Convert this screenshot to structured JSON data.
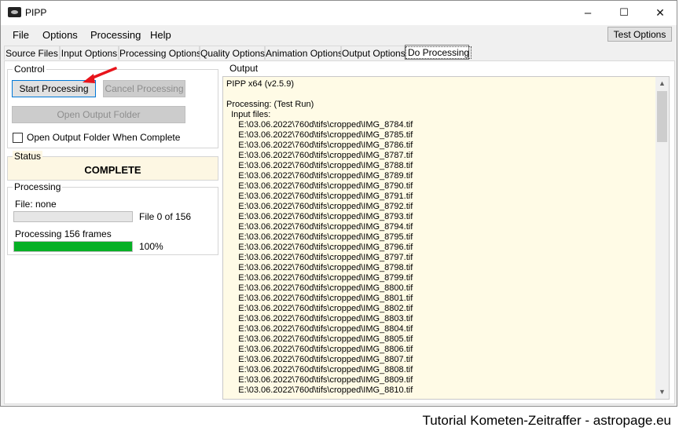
{
  "window": {
    "title": "PIPP",
    "minimize": "–",
    "maximize": "☐",
    "close": "✕"
  },
  "menu": [
    "File",
    "Options",
    "Processing",
    "Help"
  ],
  "test_options_label": "Test Options",
  "tabs": [
    "Source Files",
    "Input Options",
    "Processing Options",
    "Quality Options",
    "Animation Options",
    "Output Options",
    "Do Processing"
  ],
  "control": {
    "group_label": "Control",
    "start_label": "Start Processing",
    "cancel_label": "Cancel Processing",
    "open_folder_label": "Open Output Folder",
    "open_when_complete_label": "Open Output Folder When Complete"
  },
  "status": {
    "group_label": "Status",
    "value": "COMPLETE"
  },
  "processing": {
    "group_label": "Processing",
    "file_label": "File: none",
    "file_progress_text": "File 0 of 156",
    "file_progress": 0,
    "frames_label": "Processing 156 frames",
    "frames_percent_text": "100%",
    "frames_progress": 1.0
  },
  "output": {
    "group_label": "Output",
    "lines": [
      "PIPP x64 (v2.5.9)",
      "",
      "Processing: (Test Run)",
      "  Input files:",
      "     E:\\03.06.2022\\760d\\tifs\\cropped\\IMG_8784.tif",
      "     E:\\03.06.2022\\760d\\tifs\\cropped\\IMG_8785.tif",
      "     E:\\03.06.2022\\760d\\tifs\\cropped\\IMG_8786.tif",
      "     E:\\03.06.2022\\760d\\tifs\\cropped\\IMG_8787.tif",
      "     E:\\03.06.2022\\760d\\tifs\\cropped\\IMG_8788.tif",
      "     E:\\03.06.2022\\760d\\tifs\\cropped\\IMG_8789.tif",
      "     E:\\03.06.2022\\760d\\tifs\\cropped\\IMG_8790.tif",
      "     E:\\03.06.2022\\760d\\tifs\\cropped\\IMG_8791.tif",
      "     E:\\03.06.2022\\760d\\tifs\\cropped\\IMG_8792.tif",
      "     E:\\03.06.2022\\760d\\tifs\\cropped\\IMG_8793.tif",
      "     E:\\03.06.2022\\760d\\tifs\\cropped\\IMG_8794.tif",
      "     E:\\03.06.2022\\760d\\tifs\\cropped\\IMG_8795.tif",
      "     E:\\03.06.2022\\760d\\tifs\\cropped\\IMG_8796.tif",
      "     E:\\03.06.2022\\760d\\tifs\\cropped\\IMG_8797.tif",
      "     E:\\03.06.2022\\760d\\tifs\\cropped\\IMG_8798.tif",
      "     E:\\03.06.2022\\760d\\tifs\\cropped\\IMG_8799.tif",
      "     E:\\03.06.2022\\760d\\tifs\\cropped\\IMG_8800.tif",
      "     E:\\03.06.2022\\760d\\tifs\\cropped\\IMG_8801.tif",
      "     E:\\03.06.2022\\760d\\tifs\\cropped\\IMG_8802.tif",
      "     E:\\03.06.2022\\760d\\tifs\\cropped\\IMG_8803.tif",
      "     E:\\03.06.2022\\760d\\tifs\\cropped\\IMG_8804.tif",
      "     E:\\03.06.2022\\760d\\tifs\\cropped\\IMG_8805.tif",
      "     E:\\03.06.2022\\760d\\tifs\\cropped\\IMG_8806.tif",
      "     E:\\03.06.2022\\760d\\tifs\\cropped\\IMG_8807.tif",
      "     E:\\03.06.2022\\760d\\tifs\\cropped\\IMG_8808.tif",
      "     E:\\03.06.2022\\760d\\tifs\\cropped\\IMG_8809.tif",
      "     E:\\03.06.2022\\760d\\tifs\\cropped\\IMG_8810.tif"
    ]
  },
  "caption": "Tutorial Kometen-Zeitraffer - astropage.eu",
  "colors": {
    "progress_fill": "#06b025",
    "output_bg": "#fffbe6",
    "status_bg": "#fdf7e3",
    "arrow": "#e8141b"
  }
}
